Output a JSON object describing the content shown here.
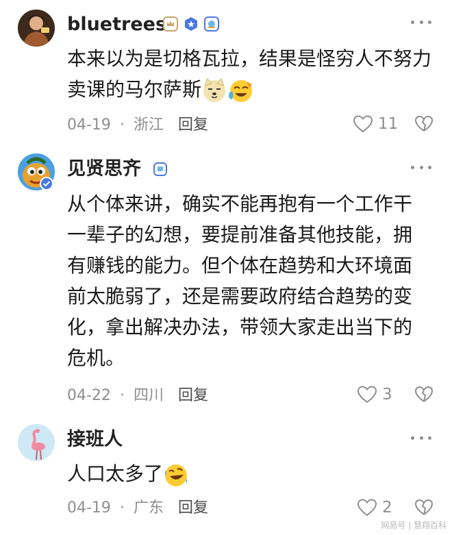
{
  "comments": [
    {
      "username": "bluetrees",
      "text": "本来以为是切格瓦拉，结果是怪穷人不努力卖课的马尔萨斯",
      "date": "04-19",
      "location": "浙江",
      "reply_label": "回复",
      "likes": "11",
      "emojis": [
        "dog-face-emoji",
        "laughing-crying-emoji"
      ]
    },
    {
      "username": "见贤思齐",
      "text": "从个体来讲，确实不能再抱有一个工作干一辈子的幻想，要提前准备其他技能，拥有赚钱的能力。但个体在趋势和大环境面前太脆弱了，还是需要政府结合趋势的变化，拿出解决办法，带领大家走出当下的危机。",
      "date": "04-22",
      "location": "四川",
      "reply_label": "回复",
      "likes": "3"
    },
    {
      "username": "接班人",
      "text": "人口太多了",
      "date": "04-19",
      "location": "广东",
      "reply_label": "回复",
      "likes": "2",
      "emojis": [
        "rolling-laughing-emoji"
      ]
    }
  ],
  "meta_separator": "·",
  "watermark": "网易号 | 慧翔百科",
  "colors": {
    "meta_gray": "#8e8e8e",
    "text_dark": "#1a1a1a",
    "verify_blue": "#4a78e0"
  }
}
